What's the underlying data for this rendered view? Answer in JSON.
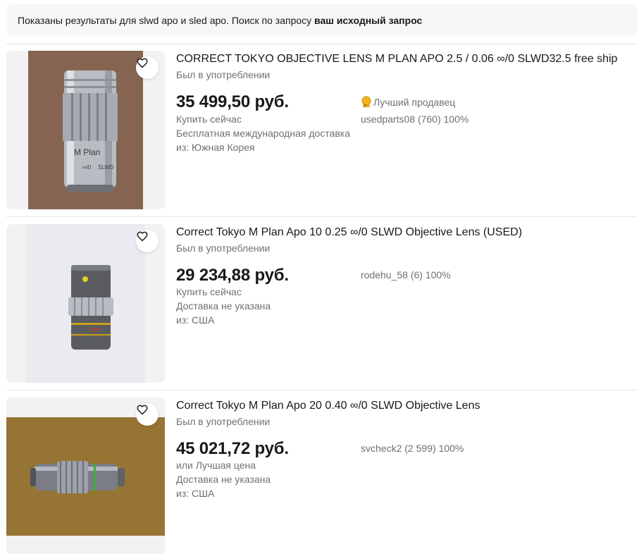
{
  "notice": {
    "prefix": "Показаны результаты для slwd apo и sled apo. Поиск по запросу",
    "link": "ваш исходный запрос"
  },
  "listings": [
    {
      "title": "CORRECT TOKYO OBJECTIVE LENS M PLAN APO 2.5 / 0.06 ∞/0 SLWD32.5 free ship",
      "condition": "Был в употреблении",
      "price": "35 499,50 руб.",
      "buy_format": "Купить сейчас",
      "shipping": "Бесплатная международная доставка",
      "origin": "из: Южная Корея",
      "top_seller_label": "Лучший продавец",
      "seller": "usedparts08 (760) 100%",
      "image_text": [
        "M Plan",
        "∞/0",
        "SLWD"
      ]
    },
    {
      "title": "Correct Tokyo M Plan Apo 10 0.25 ∞/0 SLWD Objective Lens (USED)",
      "condition": "Был в употреблении",
      "price": "29 234,88 руб.",
      "buy_format": "Купить сейчас",
      "shipping": "Доставка не указана",
      "origin": "из: США",
      "seller": "rodehu_58 (6) 100%",
      "image_text": [
        "Apo"
      ]
    },
    {
      "title": "Correct Tokyo M Plan Apo 20 0.40 ∞/0 SLWD Objective Lens",
      "condition": "Был в употреблении",
      "price": "45 021,72 руб.",
      "buy_format": "или Лучшая цена",
      "shipping": "Доставка не указана",
      "origin": "из: США",
      "seller": "svcheck2 (2 599) 100%"
    }
  ],
  "colors": {
    "text": "#191919",
    "muted": "#707070",
    "notice_bg": "#f7f7f7",
    "divider": "#e5e5e5"
  }
}
